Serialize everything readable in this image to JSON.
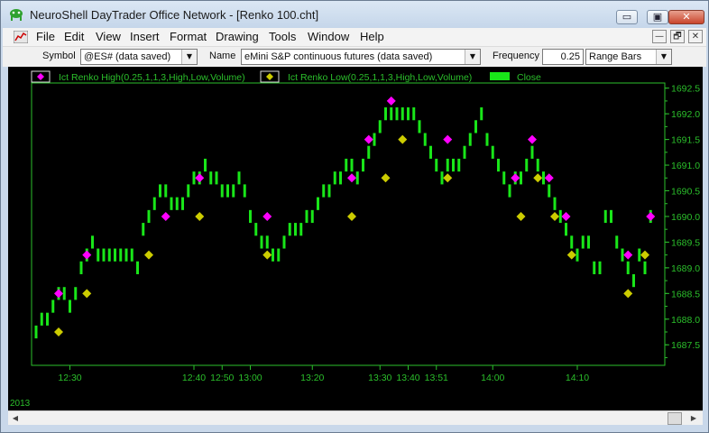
{
  "window": {
    "title": "NeuroShell DayTrader Office Network - [Renko 100.cht]",
    "buttons": {
      "minimize": "▭",
      "maximize": "▣",
      "close": "✕"
    }
  },
  "menu": {
    "items": [
      "File",
      "Edit",
      "View",
      "Insert",
      "Format",
      "Drawing",
      "Tools",
      "Window",
      "Help"
    ],
    "mdi_buttons": {
      "minimize": "—",
      "restore": "🗗",
      "close": "✕"
    }
  },
  "toolbar": {
    "symbol_label": "Symbol",
    "symbol_value": "@ES# (data saved)",
    "name_label": "Name",
    "name_value": "eMini S&P continuous futures (data saved)",
    "frequency_label": "Frequency",
    "frequency_value": "0.25",
    "bar_type": "Range Bars"
  },
  "colors": {
    "bars": "#19e619",
    "high_marker": "#ff00ff",
    "low_marker": "#cccc00",
    "axis": "#2bbf2b",
    "background": "#000000"
  },
  "chart_data": {
    "type": "bar",
    "legend": [
      {
        "name": "Ict Renko High(0.25,1,1,3,High,Low,Volume)",
        "marker": "diamond",
        "color": "#ff00ff"
      },
      {
        "name": "Ict Renko Low(0.25,1,1,3,High,Low,Volume)",
        "marker": "diamond",
        "color": "#cccc00"
      },
      {
        "name": "Close",
        "marker": "box",
        "color": "#19e619"
      }
    ],
    "y_ticks": [
      1687.5,
      1688.0,
      1688.5,
      1689.0,
      1689.5,
      1690.0,
      1690.5,
      1691.0,
      1691.5,
      1692.0,
      1692.5
    ],
    "ylim": [
      1687.1,
      1692.6
    ],
    "x_ticks": [
      {
        "i": 6,
        "label": "12:30"
      },
      {
        "i": 28,
        "label": "12:40"
      },
      {
        "i": 33,
        "label": "12:50"
      },
      {
        "i": 38,
        "label": "13:00"
      },
      {
        "i": 49,
        "label": "13:20"
      },
      {
        "i": 61,
        "label": "13:30"
      },
      {
        "i": 66,
        "label": "13:40"
      },
      {
        "i": 71,
        "label": "13:51"
      },
      {
        "i": 81,
        "label": "14:00"
      },
      {
        "i": 96,
        "label": "14:10"
      }
    ],
    "x_start_label": "2013",
    "closes": [
      1687.75,
      1688.0,
      1688.0,
      1688.25,
      1688.5,
      1688.5,
      1688.25,
      1688.5,
      1689.0,
      1689.25,
      1689.5,
      1689.25,
      1689.25,
      1689.25,
      1689.25,
      1689.25,
      1689.25,
      1689.25,
      1689.0,
      1689.75,
      1690.0,
      1690.25,
      1690.5,
      1690.5,
      1690.25,
      1690.25,
      1690.25,
      1690.5,
      1690.75,
      1690.75,
      1691.0,
      1690.75,
      1690.75,
      1690.5,
      1690.5,
      1690.5,
      1690.75,
      1690.5,
      1690.0,
      1689.75,
      1689.5,
      1689.5,
      1689.25,
      1689.25,
      1689.5,
      1689.75,
      1689.75,
      1689.75,
      1690.0,
      1690.0,
      1690.25,
      1690.5,
      1690.5,
      1690.75,
      1690.75,
      1691.0,
      1691.0,
      1690.75,
      1691.0,
      1691.25,
      1691.5,
      1691.75,
      1692.0,
      1692.0,
      1692.0,
      1692.0,
      1692.0,
      1692.0,
      1691.75,
      1691.5,
      1691.25,
      1691.0,
      1690.75,
      1691.0,
      1691.0,
      1691.0,
      1691.25,
      1691.5,
      1691.75,
      1692.0,
      1691.5,
      1691.25,
      1691.0,
      1690.75,
      1690.5,
      1690.75,
      1690.75,
      1691.0,
      1691.25,
      1691.0,
      1690.75,
      1690.5,
      1690.25,
      1690.0,
      1689.75,
      1689.5,
      1689.25,
      1689.5,
      1689.5,
      1689.0,
      1689.0,
      1690.0,
      1690.0,
      1689.5,
      1689.25,
      1689.0,
      1688.75,
      1689.25,
      1689.0,
      1690.0
    ],
    "high_markers": [
      {
        "i": 4,
        "y": 1688.5
      },
      {
        "i": 9,
        "y": 1689.25
      },
      {
        "i": 23,
        "y": 1690.0
      },
      {
        "i": 29,
        "y": 1690.75
      },
      {
        "i": 41,
        "y": 1690.0
      },
      {
        "i": 56,
        "y": 1690.75
      },
      {
        "i": 59,
        "y": 1691.5
      },
      {
        "i": 63,
        "y": 1692.25
      },
      {
        "i": 73,
        "y": 1691.5
      },
      {
        "i": 85,
        "y": 1690.75
      },
      {
        "i": 88,
        "y": 1691.5
      },
      {
        "i": 91,
        "y": 1690.75
      },
      {
        "i": 94,
        "y": 1690.0
      },
      {
        "i": 105,
        "y": 1689.25
      },
      {
        "i": 109,
        "y": 1690.0
      }
    ],
    "low_markers": [
      {
        "i": 4,
        "y": 1687.75
      },
      {
        "i": 9,
        "y": 1688.5
      },
      {
        "i": 20,
        "y": 1689.25
      },
      {
        "i": 29,
        "y": 1690.0
      },
      {
        "i": 41,
        "y": 1689.25
      },
      {
        "i": 56,
        "y": 1690.0
      },
      {
        "i": 62,
        "y": 1690.75
      },
      {
        "i": 65,
        "y": 1691.5
      },
      {
        "i": 73,
        "y": 1690.75
      },
      {
        "i": 86,
        "y": 1690.0
      },
      {
        "i": 89,
        "y": 1690.75
      },
      {
        "i": 92,
        "y": 1690.0
      },
      {
        "i": 95,
        "y": 1689.25
      },
      {
        "i": 105,
        "y": 1688.5
      },
      {
        "i": 108,
        "y": 1689.25
      }
    ]
  }
}
